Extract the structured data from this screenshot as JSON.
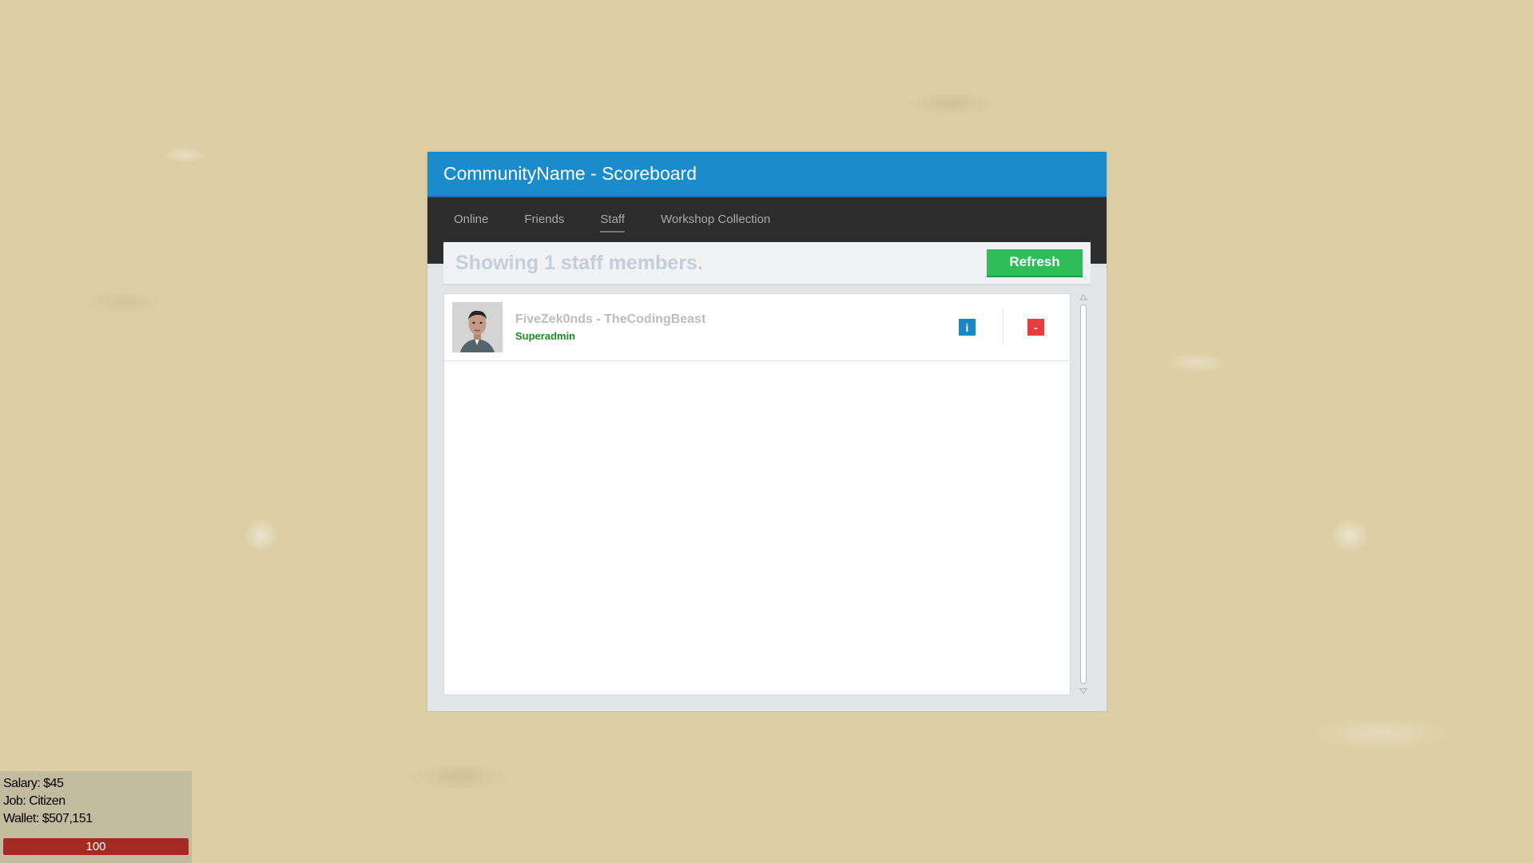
{
  "scoreboard": {
    "title": "CommunityName - Scoreboard",
    "tabs": [
      {
        "label": "Online",
        "active": false
      },
      {
        "label": "Friends",
        "active": false
      },
      {
        "label": "Staff",
        "active": true
      },
      {
        "label": "Workshop Collection",
        "active": false
      }
    ],
    "status_text": "Showing 1 staff members.",
    "refresh_label": "Refresh",
    "players": [
      {
        "name": "FiveZek0nds - TheCodingBeast",
        "rank": "Superadmin",
        "info_label": "i",
        "remove_label": "-"
      }
    ]
  },
  "hud": {
    "salary": "Salary: $45",
    "job": "Job: Citizen",
    "wallet": "Wallet: $507,151",
    "health": "100",
    "health_fraction": 1.0
  },
  "colors": {
    "title_bar": "#1a8bcb",
    "nav_bar": "#2d2d2d",
    "refresh_button": "#2ebd59",
    "rank_text": "#1f8a25",
    "info_button": "#1a87c4",
    "remove_button": "#e33d3d",
    "health_bar": "#a52a24"
  },
  "icons": {
    "scroll_up": "triangle-up-icon",
    "scroll_down": "triangle-down-icon"
  }
}
